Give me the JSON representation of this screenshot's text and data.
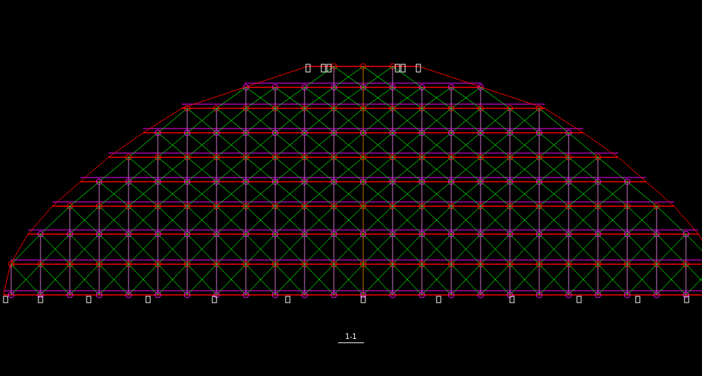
{
  "drawing": {
    "section_label": "1-1"
  }
}
